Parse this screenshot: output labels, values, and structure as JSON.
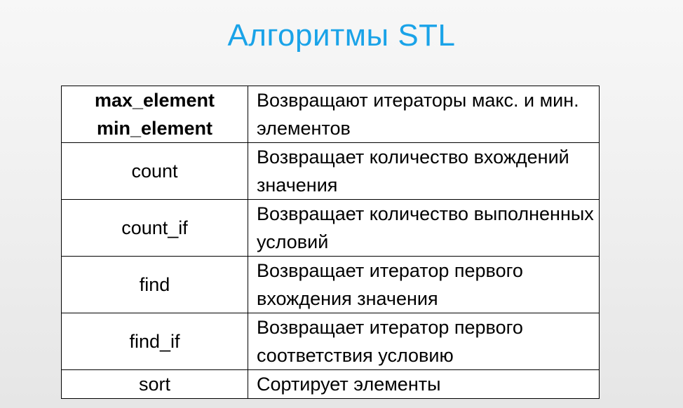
{
  "title": "Алгоритмы STL",
  "table": {
    "rows": [
      {
        "names": [
          "max_element",
          "min_element"
        ],
        "bold": true,
        "description": "Возвращают итераторы макс. и мин. элементов"
      },
      {
        "names": [
          "count"
        ],
        "bold": false,
        "description": "Возвращает  количество вхождений значения"
      },
      {
        "names": [
          "count_if"
        ],
        "bold": false,
        "description": "Возвращает  количество выполненных условий"
      },
      {
        "names": [
          "find"
        ],
        "bold": false,
        "description": "Возвращает итератор первого вхождения значения"
      },
      {
        "names": [
          "find_if"
        ],
        "bold": false,
        "description": "Возвращает итератор первого соответствия условию"
      },
      {
        "names": [
          "sort"
        ],
        "bold": false,
        "description": "Сортирует элементы"
      }
    ]
  }
}
